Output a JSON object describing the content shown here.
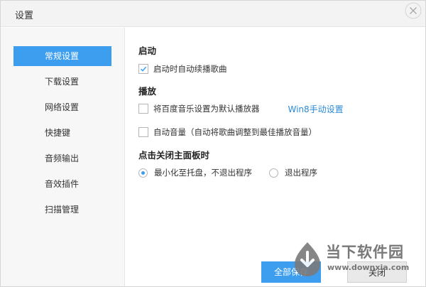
{
  "window": {
    "title": "设置"
  },
  "sidebar": {
    "items": [
      {
        "label": "常规设置",
        "active": true
      },
      {
        "label": "下载设置",
        "active": false
      },
      {
        "label": "网络设置",
        "active": false
      },
      {
        "label": "快捷键",
        "active": false
      },
      {
        "label": "音频输出",
        "active": false
      },
      {
        "label": "音效插件",
        "active": false
      },
      {
        "label": "扫描管理",
        "active": false
      }
    ]
  },
  "sections": {
    "startup": {
      "title": "启动",
      "autoplay_label": "启动时自动续播歌曲",
      "autoplay_checked": true
    },
    "playback": {
      "title": "播放",
      "default_player_label": "将百度音乐设置为默认播放器",
      "default_player_checked": false,
      "win8_link": "Win8手动设置",
      "auto_volume_label": "自动音量（自动将歌曲调整到最佳播放音量）",
      "auto_volume_checked": false
    },
    "close_behavior": {
      "title": "点击关闭主面板时",
      "options": [
        {
          "label": "最小化至托盘，不退出程序",
          "selected": true
        },
        {
          "label": "退出程序",
          "selected": false
        }
      ]
    }
  },
  "footer": {
    "save_all_label": "全部保存",
    "close_label": "关闭"
  },
  "watermark": {
    "title": "当下软件园",
    "url": "www.downxia.com"
  },
  "colors": {
    "accent": "#3d9ef0",
    "link": "#2a8ad8"
  }
}
